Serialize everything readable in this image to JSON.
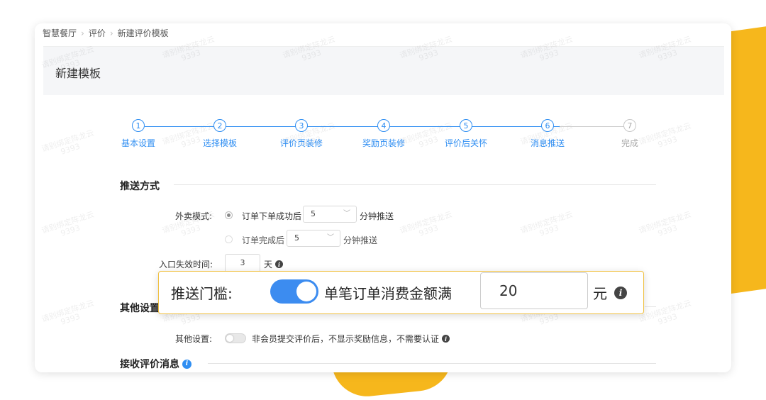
{
  "breadcrumb": [
    "智慧餐厅",
    "评价",
    "新建评价模板"
  ],
  "page_title": "新建模板",
  "steps": [
    {
      "num": "1",
      "label": "基本设置",
      "done": true
    },
    {
      "num": "2",
      "label": "选择模板",
      "done": true
    },
    {
      "num": "3",
      "label": "评价页装修",
      "done": true
    },
    {
      "num": "4",
      "label": "奖励页装修",
      "done": true
    },
    {
      "num": "5",
      "label": "评价后关怀",
      "done": true
    },
    {
      "num": "6",
      "label": "消息推送",
      "done": true
    },
    {
      "num": "7",
      "label": "完成",
      "done": false
    }
  ],
  "push_method": {
    "section_title": "推送方式",
    "takeout_label": "外卖模式:",
    "option1_text": "订单下单成功后",
    "option1_value": "5",
    "option1_suffix": "分钟推送",
    "option2_text": "订单完成后",
    "option2_value": "5",
    "option2_suffix": "分钟推送",
    "expire_label": "入口失效时间:",
    "expire_value": "3",
    "expire_unit": "天"
  },
  "other": {
    "section_title": "其他设置",
    "label": "其他设置:",
    "switch_text": "非会员提交评价后，不显示奖励信息，不需要认证"
  },
  "receive": {
    "section_title": "接收评价消息"
  },
  "callout": {
    "label": "推送门槛:",
    "text": "单笔订单消费金额满",
    "value": "20",
    "unit": "元",
    "switch_on": true
  },
  "watermark": {
    "line1": "请别绑定阵龙云",
    "line2": "9393"
  },
  "colors": {
    "accent": "#2f8ef2",
    "background_shape": "#f6b71c",
    "switch_on": "#3c8cf0"
  }
}
